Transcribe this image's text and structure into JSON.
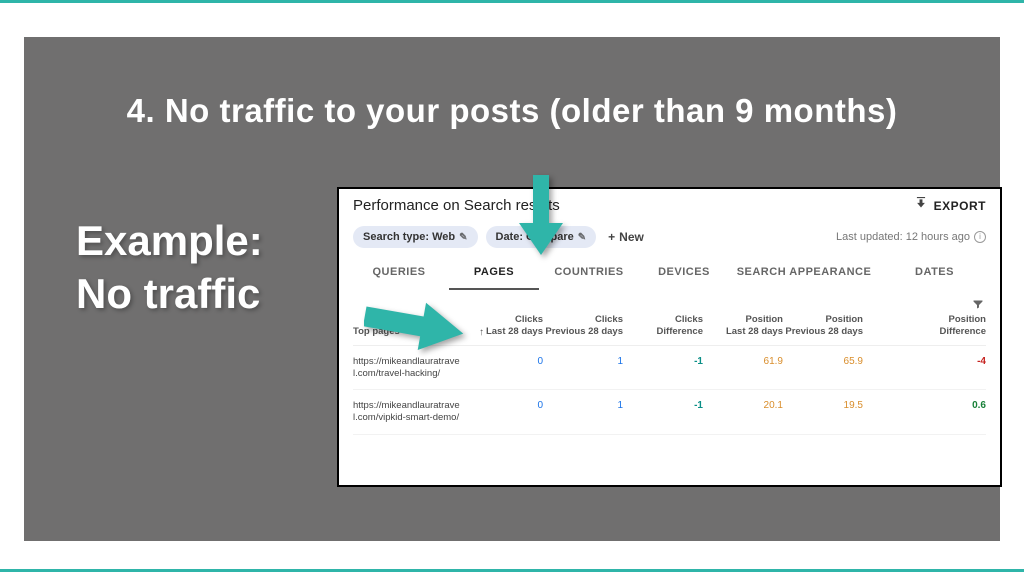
{
  "slide": {
    "title": "4. No traffic to your posts (older than 9 months)",
    "example_line1": "Example:",
    "example_line2": "No traffic"
  },
  "header": {
    "title": "Performance on Search results",
    "export_label": "EXPORT"
  },
  "filters": {
    "chip1": "Search type: Web",
    "chip2": "Date: Compare",
    "new_label": "New",
    "last_updated": "Last updated: 12 hours ago"
  },
  "tabs": {
    "queries": "QUERIES",
    "pages": "PAGES",
    "countries": "COUNTRIES",
    "devices": "DEVICES",
    "search_appearance": "SEARCH APPEARANCE",
    "dates": "DATES"
  },
  "table": {
    "header": {
      "top_pages": "Top pages",
      "clicks_l28_line1": "Clicks",
      "clicks_l28_line2": "Last 28 days",
      "clicks_p28_line1": "Clicks",
      "clicks_p28_line2": "Previous 28 days",
      "clicks_diff_line1": "Clicks",
      "clicks_diff_line2": "Difference",
      "pos_l28_line1": "Position",
      "pos_l28_line2": "Last 28 days",
      "pos_p28_line1": "Position",
      "pos_p28_line2": "Previous 28 days",
      "pos_diff_line1": "Position",
      "pos_diff_line2": "Difference"
    },
    "rows": [
      {
        "url": "https://mikeandlauratravel.com/travel-hacking/",
        "clicks_l28": "0",
        "clicks_p28": "1",
        "clicks_diff": "-1",
        "pos_l28": "61.9",
        "pos_p28": "65.9",
        "pos_diff": "-4",
        "diff_class": "red"
      },
      {
        "url": "https://mikeandlauratravel.com/vipkid-smart-demo/",
        "clicks_l28": "0",
        "clicks_p28": "1",
        "clicks_diff": "-1",
        "pos_l28": "20.1",
        "pos_p28": "19.5",
        "pos_diff": "0.6",
        "diff_class": "green"
      }
    ]
  }
}
